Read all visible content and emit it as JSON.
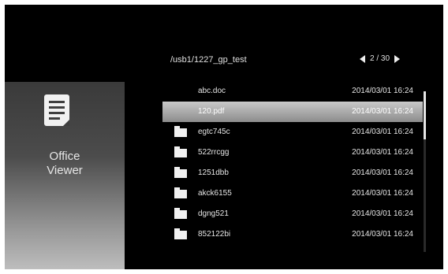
{
  "app": {
    "name_line1": "Office",
    "name_line2": "Viewer",
    "icon": "document-icon"
  },
  "path": "/usb1/1227_gp_test",
  "pager": {
    "text": "2 / 30"
  },
  "files": [
    {
      "name": "abc.doc",
      "date": "2014/03/01  16:24",
      "type": "file"
    },
    {
      "name": "120.pdf",
      "date": "2014/03/01  16:24",
      "type": "file",
      "selected": true
    },
    {
      "name": "egtc745c",
      "date": "2014/03/01  16:24",
      "type": "folder"
    },
    {
      "name": "522rrcgg",
      "date": "2014/03/01  16:24",
      "type": "folder"
    },
    {
      "name": "1251dbb",
      "date": "2014/03/01  16:24",
      "type": "folder"
    },
    {
      "name": "akck6155",
      "date": "2014/03/01  16:24",
      "type": "folder"
    },
    {
      "name": "dgng521",
      "date": "2014/03/01  16:24",
      "type": "folder"
    },
    {
      "name": "852122bi",
      "date": "2014/03/01  16:24",
      "type": "folder"
    }
  ],
  "scrollbar": {
    "position_fraction": 0.0,
    "visible_fraction": 0.3
  }
}
